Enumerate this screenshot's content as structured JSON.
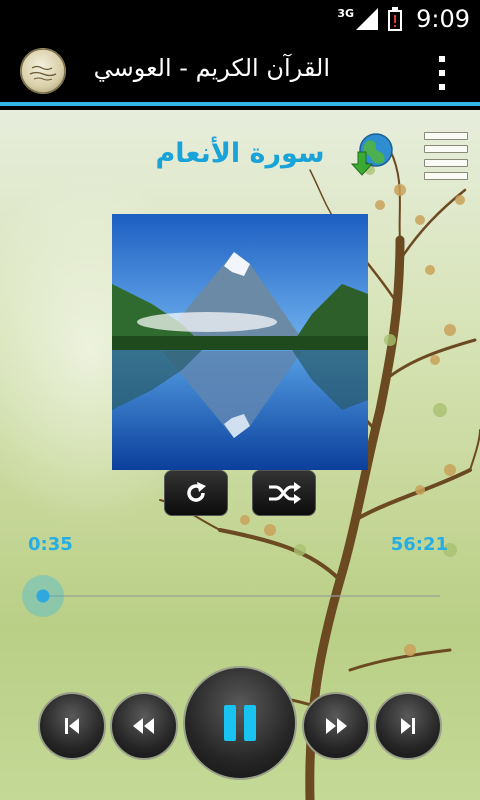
{
  "status_bar": {
    "network": "3G",
    "time": "9:09"
  },
  "action_bar": {
    "title": "القرآن الكريم - العوسي",
    "logo_icon": "app-logo-icon",
    "menu_icon": "overflow-menu-icon"
  },
  "player": {
    "surah_title": "سورة الأنعام",
    "elapsed": "0:35",
    "total": "56:21",
    "progress": 0.01,
    "accent_color": "#33b5e5",
    "icons": {
      "download": "globe-download-icon",
      "playlist": "list-menu-icon",
      "repeat": "repeat-icon",
      "shuffle": "shuffle-icon",
      "prev": "skip-previous-icon",
      "rewind": "rewind-icon",
      "pause": "pause-icon",
      "forward": "fast-forward-icon",
      "next": "skip-next-icon"
    }
  }
}
